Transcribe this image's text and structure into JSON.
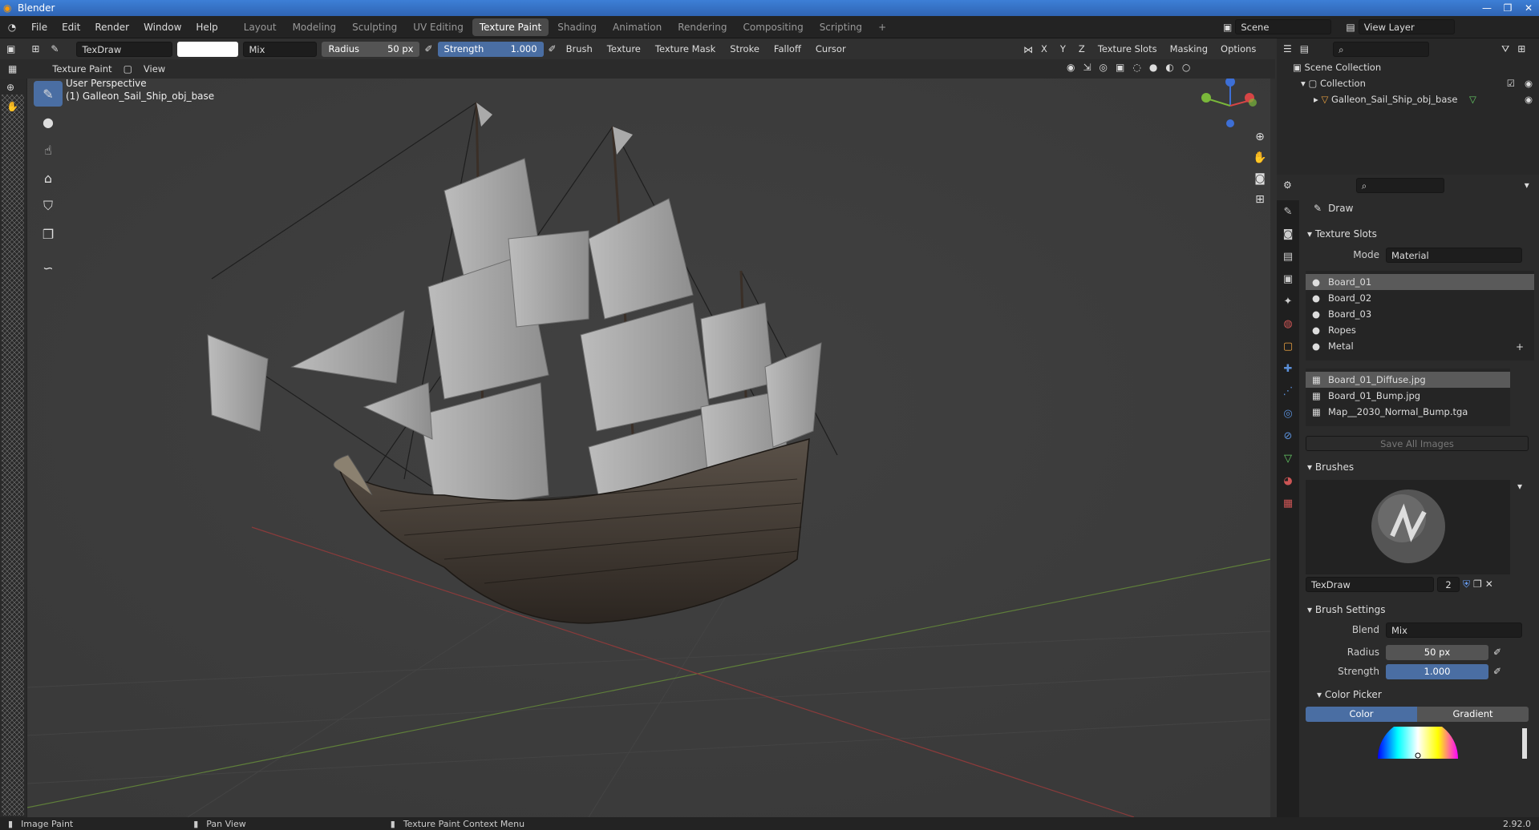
{
  "window": {
    "title": "Blender"
  },
  "menu": [
    "File",
    "Edit",
    "Render",
    "Window",
    "Help"
  ],
  "workspaces": [
    "Layout",
    "Modeling",
    "Sculpting",
    "UV Editing",
    "Texture Paint",
    "Shading",
    "Animation",
    "Rendering",
    "Compositing",
    "Scripting"
  ],
  "active_workspace": "Texture Paint",
  "scene": {
    "name": "Scene",
    "view_layer": "View Layer"
  },
  "tool_header": {
    "brush_name": "TexDraw",
    "blend": "Mix",
    "radius_label": "Radius",
    "radius_value": "50 px",
    "strength_label": "Strength",
    "strength_value": "1.000",
    "menus": [
      "Brush",
      "Texture",
      "Texture Mask",
      "Stroke",
      "Falloff",
      "Cursor"
    ],
    "axes": [
      "X",
      "Y",
      "Z"
    ],
    "right_menus": [
      "Texture Slots",
      "Masking",
      "Options"
    ]
  },
  "editor_header": {
    "mode": "Texture Paint",
    "view": "View"
  },
  "viewport": {
    "perspective": "User Perspective",
    "object_label": "(1) Galleon_Sail_Ship_obj_base"
  },
  "outliner": {
    "root": "Scene Collection",
    "collection": "Collection",
    "object": "Galleon_Sail_Ship_obj_base"
  },
  "properties": {
    "tool_name": "Draw",
    "texture_slots": {
      "title": "Texture Slots",
      "mode_label": "Mode",
      "mode_value": "Material",
      "materials": [
        "Board_01",
        "Board_02",
        "Board_03",
        "Ropes",
        "Metal"
      ],
      "images": [
        "Board_01_Diffuse.jpg",
        "Board_01_Bump.jpg",
        "Map__2030_Normal_Bump.tga"
      ],
      "save_all": "Save All Images"
    },
    "brushes": {
      "title": "Brushes",
      "brush_name": "TexDraw",
      "users": "2"
    },
    "brush_settings": {
      "title": "Brush Settings",
      "blend_label": "Blend",
      "blend_value": "Mix",
      "radius_label": "Radius",
      "radius_value": "50 px",
      "strength_label": "Strength",
      "strength_value": "1.000",
      "color_picker": "Color Picker",
      "tab_color": "Color",
      "tab_gradient": "Gradient"
    }
  },
  "statusbar": {
    "left": "Image Paint",
    "mid": "Pan View",
    "right": "Texture Paint Context Menu",
    "version": "2.92.0"
  },
  "colors": {
    "accent": "#4a6ea3",
    "selected": "#5a5a5a",
    "bg": "#303030"
  }
}
